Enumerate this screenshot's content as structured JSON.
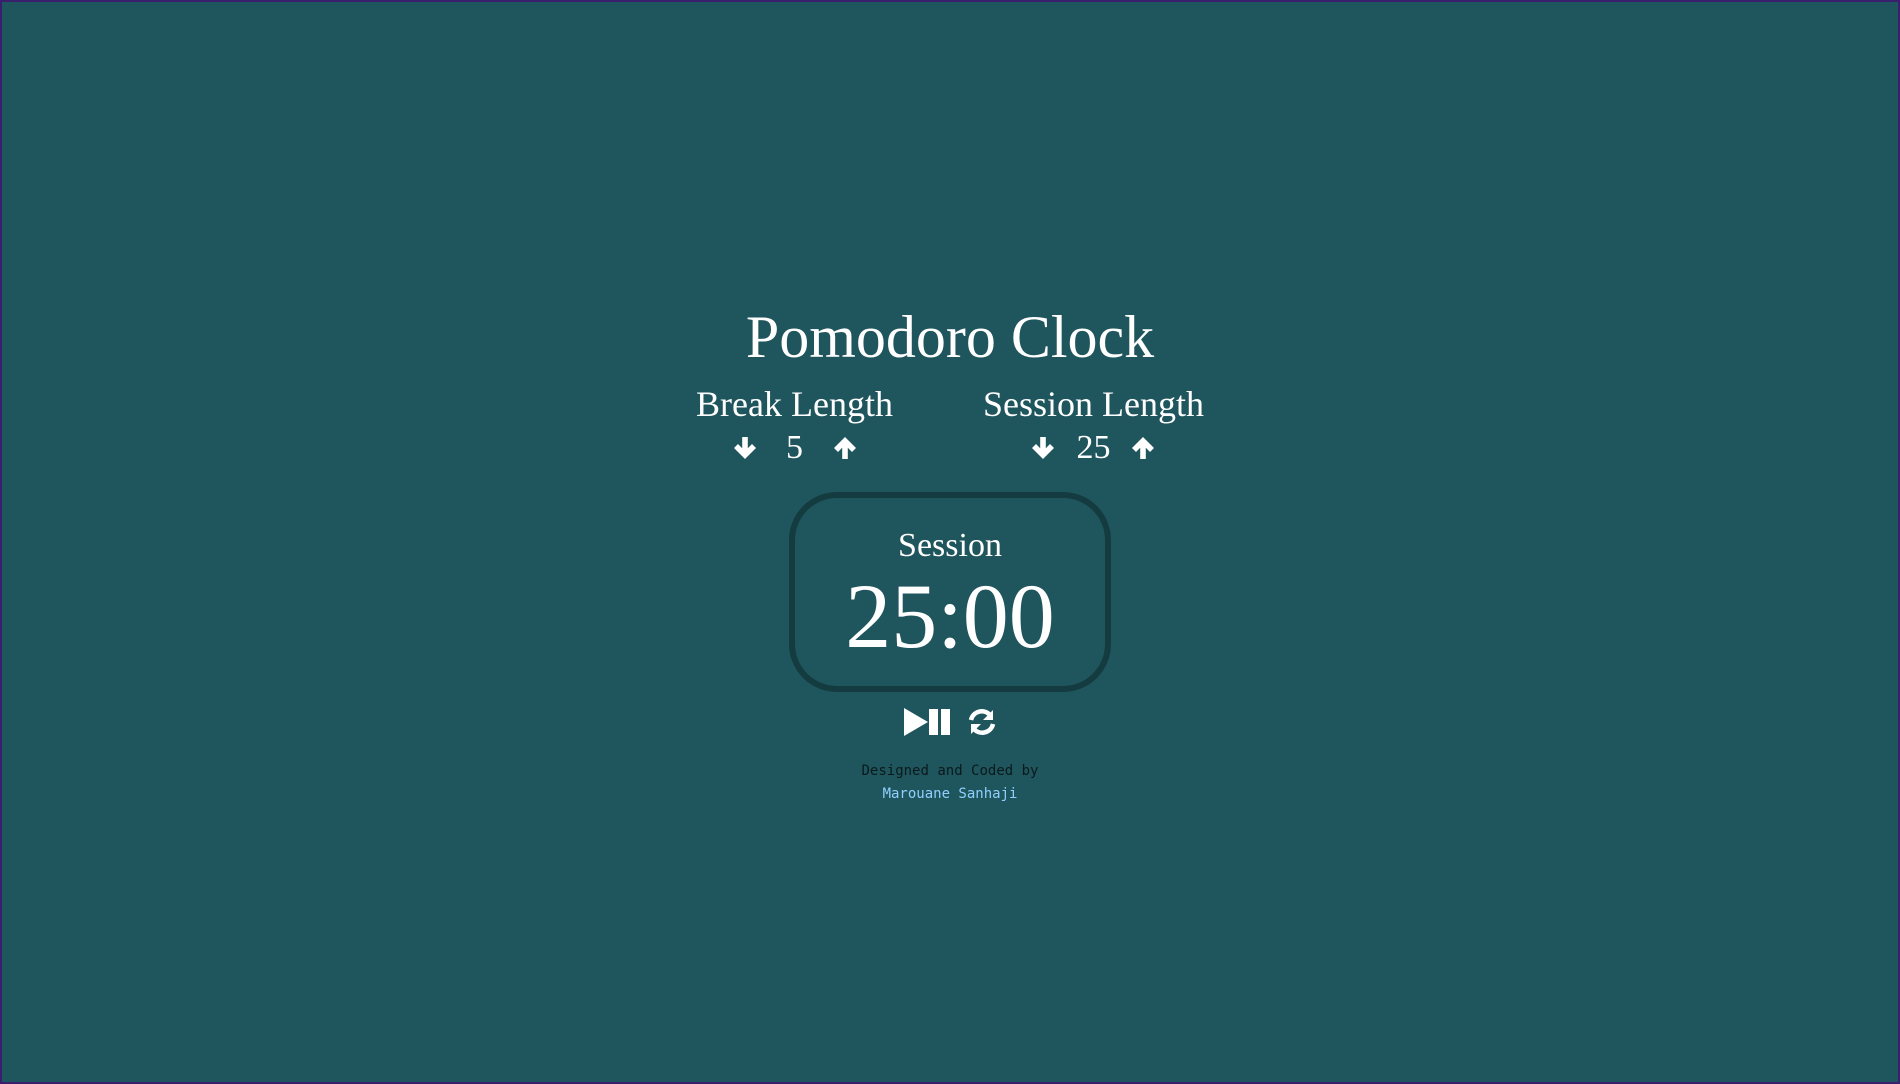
{
  "app": {
    "title": "Pomodoro Clock"
  },
  "break": {
    "label": "Break Length",
    "value": "5",
    "decrement_icon": "arrow-down-icon",
    "increment_icon": "arrow-up-icon"
  },
  "session": {
    "label": "Session Length",
    "value": "25",
    "decrement_icon": "arrow-down-icon",
    "increment_icon": "arrow-up-icon"
  },
  "timer": {
    "label": "Session",
    "time": "25:00"
  },
  "controls": {
    "play_pause_icon": "play-pause-icon",
    "reset_icon": "refresh-icon"
  },
  "credits": {
    "line": "Designed and Coded by",
    "author": "Marouane Sanhaji"
  },
  "colors": {
    "background": "#1f555c",
    "timer_border": "#143b3f",
    "text": "#ffffff",
    "credit_text": "#0a1a1c",
    "author_link": "#8fd0ff"
  }
}
